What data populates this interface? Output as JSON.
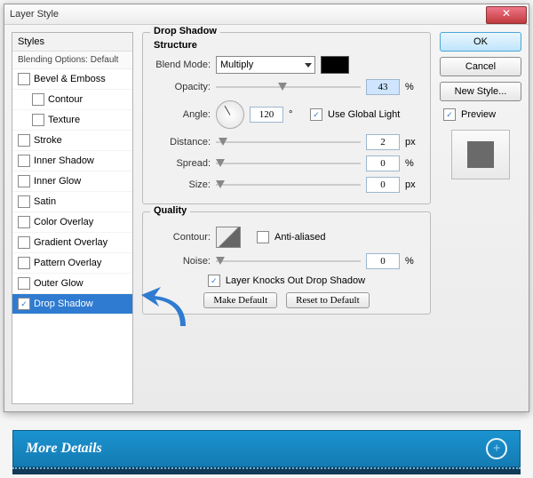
{
  "window": {
    "title": "Layer Style"
  },
  "styles": {
    "header": "Styles",
    "blending": "Blending Options: Default",
    "items": [
      {
        "label": "Bevel & Emboss",
        "checked": false,
        "indent": false,
        "selected": false
      },
      {
        "label": "Contour",
        "checked": false,
        "indent": true,
        "selected": false
      },
      {
        "label": "Texture",
        "checked": false,
        "indent": true,
        "selected": false
      },
      {
        "label": "Stroke",
        "checked": false,
        "indent": false,
        "selected": false
      },
      {
        "label": "Inner Shadow",
        "checked": false,
        "indent": false,
        "selected": false
      },
      {
        "label": "Inner Glow",
        "checked": false,
        "indent": false,
        "selected": false
      },
      {
        "label": "Satin",
        "checked": false,
        "indent": false,
        "selected": false
      },
      {
        "label": "Color Overlay",
        "checked": false,
        "indent": false,
        "selected": false
      },
      {
        "label": "Gradient Overlay",
        "checked": false,
        "indent": false,
        "selected": false
      },
      {
        "label": "Pattern Overlay",
        "checked": false,
        "indent": false,
        "selected": false
      },
      {
        "label": "Outer Glow",
        "checked": false,
        "indent": false,
        "selected": false
      },
      {
        "label": "Drop Shadow",
        "checked": true,
        "indent": false,
        "selected": true
      }
    ]
  },
  "main": {
    "title": "Drop Shadow",
    "structure": "Structure",
    "blendMode": {
      "label": "Blend Mode:",
      "value": "Multiply"
    },
    "opacity": {
      "label": "Opacity:",
      "value": "43",
      "unit": "%"
    },
    "angle": {
      "label": "Angle:",
      "value": "120",
      "unit": "°",
      "global": "Use Global Light"
    },
    "distance": {
      "label": "Distance:",
      "value": "2",
      "unit": "px"
    },
    "spread": {
      "label": "Spread:",
      "value": "0",
      "unit": "%"
    },
    "size": {
      "label": "Size:",
      "value": "0",
      "unit": "px"
    }
  },
  "quality": {
    "title": "Quality",
    "contour": {
      "label": "Contour:",
      "anti": "Anti-aliased"
    },
    "noise": {
      "label": "Noise:",
      "value": "0",
      "unit": "%"
    },
    "knockout": "Layer Knocks Out Drop Shadow",
    "makeDefault": "Make Default",
    "resetDefault": "Reset to Default"
  },
  "right": {
    "ok": "OK",
    "cancel": "Cancel",
    "newStyle": "New Style...",
    "preview": "Preview"
  },
  "banner": {
    "text": "More Details"
  }
}
